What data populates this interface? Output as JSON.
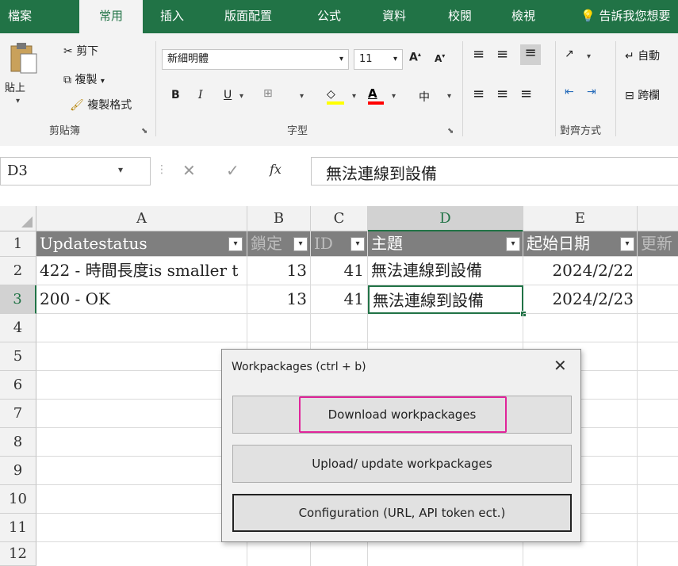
{
  "tabs": [
    "檔案",
    "常用",
    "插入",
    "版面配置",
    "公式",
    "資料",
    "校閱",
    "檢視"
  ],
  "tab_search": "告訴我您想要",
  "ribbon": {
    "clipboard": {
      "paste": "貼上",
      "cut": "剪下",
      "copy": "複製",
      "format_painter": "複製格式",
      "label": "剪貼簿"
    },
    "font": {
      "name": "新細明體",
      "size": "11",
      "grow": "A",
      "shrink": "A",
      "bold": "B",
      "italic": "I",
      "underline": "U",
      "font_color": "A",
      "phonetic": "中",
      "label": "字型"
    },
    "alignment": {
      "wrap": "自動",
      "merge": "跨欄",
      "label": "對齊方式"
    }
  },
  "formula_bar": {
    "name_box": "D3",
    "fx": "fx",
    "value": "無法連線到設備"
  },
  "grid": {
    "columns": [
      "A",
      "B",
      "C",
      "D",
      "E"
    ],
    "rows": [
      "1",
      "2",
      "3",
      "4",
      "5",
      "6",
      "7",
      "8",
      "9",
      "10",
      "11",
      "12"
    ],
    "header": [
      "Updatestatus",
      "鎖定",
      "ID",
      "主題",
      "起始日期",
      "更新"
    ],
    "data": [
      [
        "422 - 時間長度is smaller t",
        "13",
        "41",
        "無法連線到設備",
        "2024/2/22"
      ],
      [
        "200 - OK",
        "13",
        "41",
        "無法連線到設備",
        "2024/2/23"
      ]
    ]
  },
  "dialog": {
    "title": "Workpackages (ctrl + b)",
    "close": "✕",
    "buttons": [
      "Download workpackages",
      "Upload/ update workpackages",
      "Configuration (URL, API token ect.)"
    ]
  },
  "colors": {
    "excel_green": "#217346",
    "header_gray": "#7f7f7f",
    "highlight": "#e0249a"
  }
}
